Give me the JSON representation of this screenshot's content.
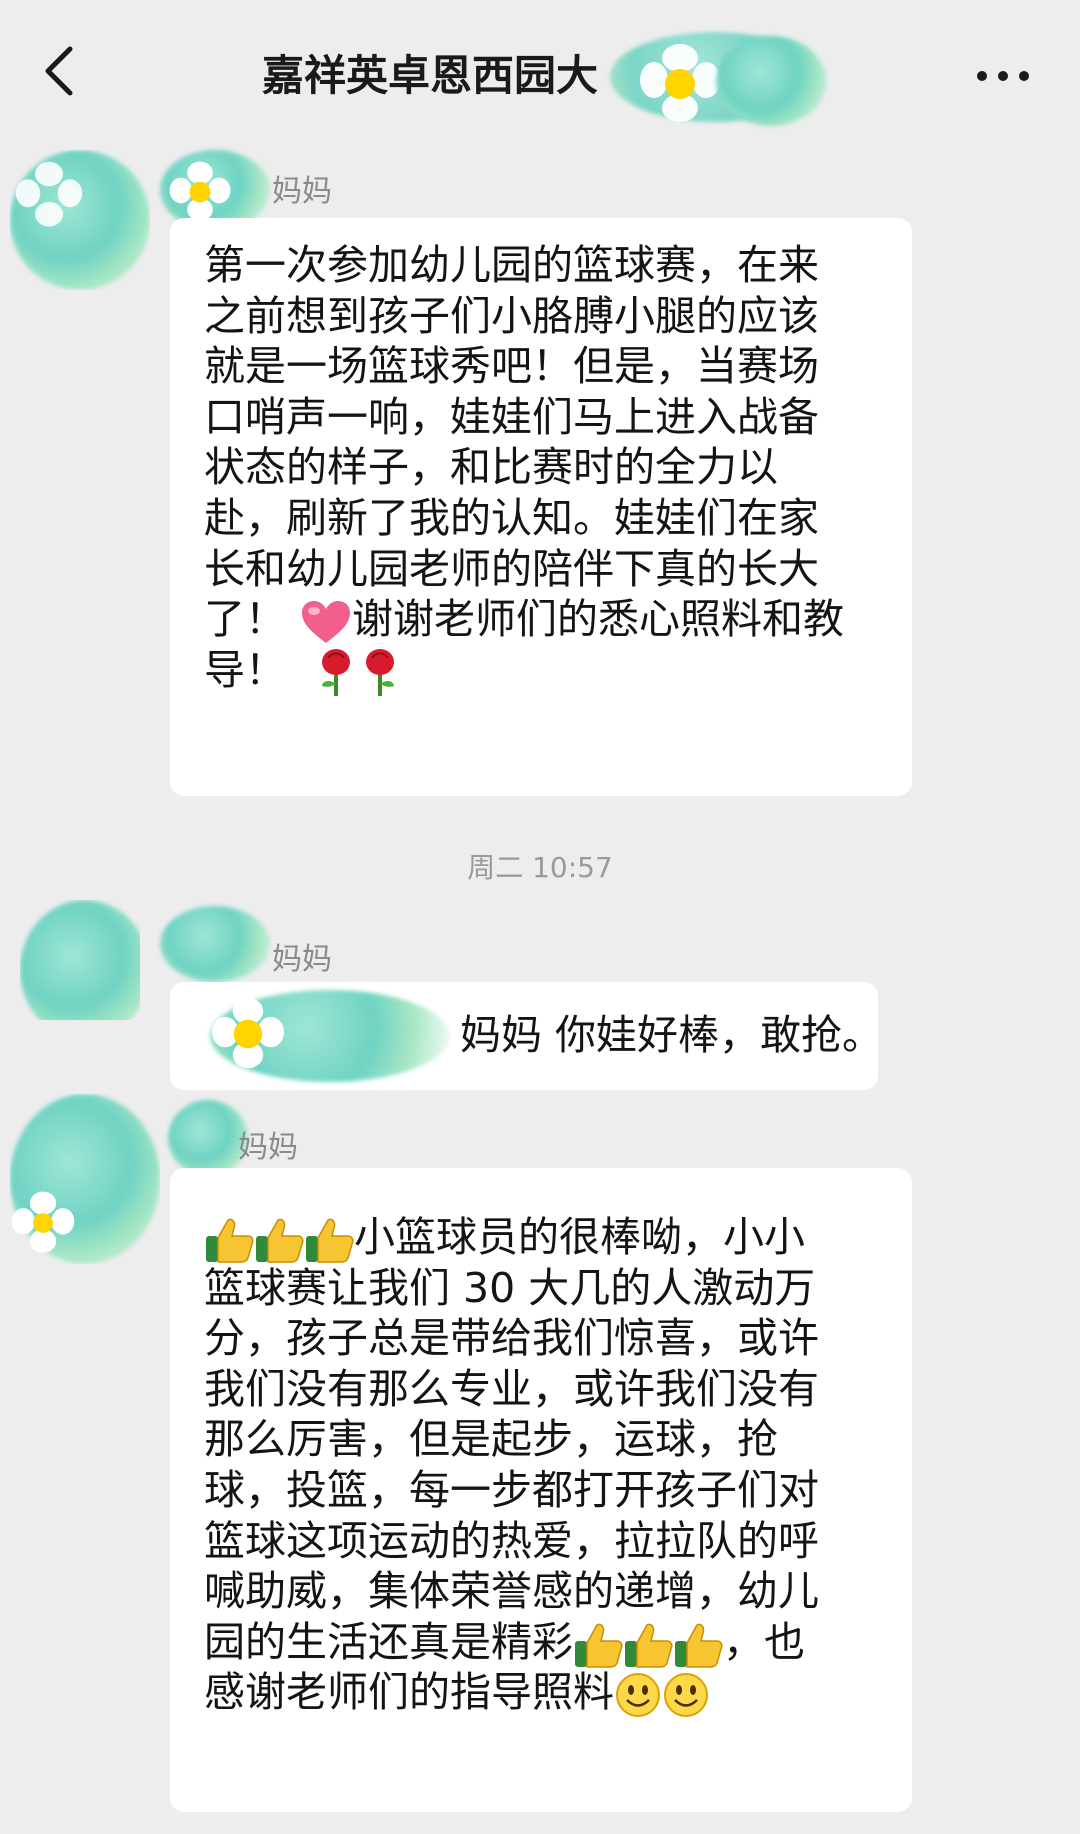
{
  "header": {
    "title": "嘉祥英卓恩西园大"
  },
  "messages": [
    {
      "sender": "妈妈",
      "lines": [
        "第一次参加幼儿园的篮球赛，在来",
        "之前想到孩子们小胳膊小腿的应该",
        "就是一场篮球秀吧！但是，当赛场",
        "口哨声一响，娃娃们马上进入战备",
        "状态的样子，和比赛时的全力以",
        "赴，刷新了我的认知。娃娃们在家",
        "长和幼儿园老师的陪伴下真的长大",
        "了！",
        "谢谢老师们的悉心照料和教",
        "导！"
      ]
    },
    {
      "timestamp": "周二 10:57"
    },
    {
      "sender": "妈妈",
      "text": "妈妈  你娃好棒，敢抢。"
    },
    {
      "sender": "妈妈",
      "lines": [
        "小篮球员的很棒呦，小小",
        "篮球赛让我们 30 大几的人激动万",
        "分，孩子总是带给我们惊喜，或许",
        "我们没有那么专业，或许我们没有",
        "那么厉害，但是起步，运球，抢",
        "球，投篮，每一步都打开孩子们对",
        "篮球这项运动的热爱，拉拉队的呼",
        "喊助威，集体荣誉感的递增，幼儿",
        "园的生活还真是精彩",
        "，也",
        "感谢老师们的指导照料"
      ]
    }
  ],
  "icons": {
    "back": "chevron-left-icon",
    "more": "more-dots-icon",
    "heart": "heart-emoji",
    "rose": "rose-emoji",
    "thumbs_up": "thumbs-up-emoji",
    "smile": "smile-emoji"
  },
  "colors": {
    "background": "#ededed",
    "bubble": "#ffffff",
    "text": "#141414",
    "meta": "#8a8a8a"
  }
}
